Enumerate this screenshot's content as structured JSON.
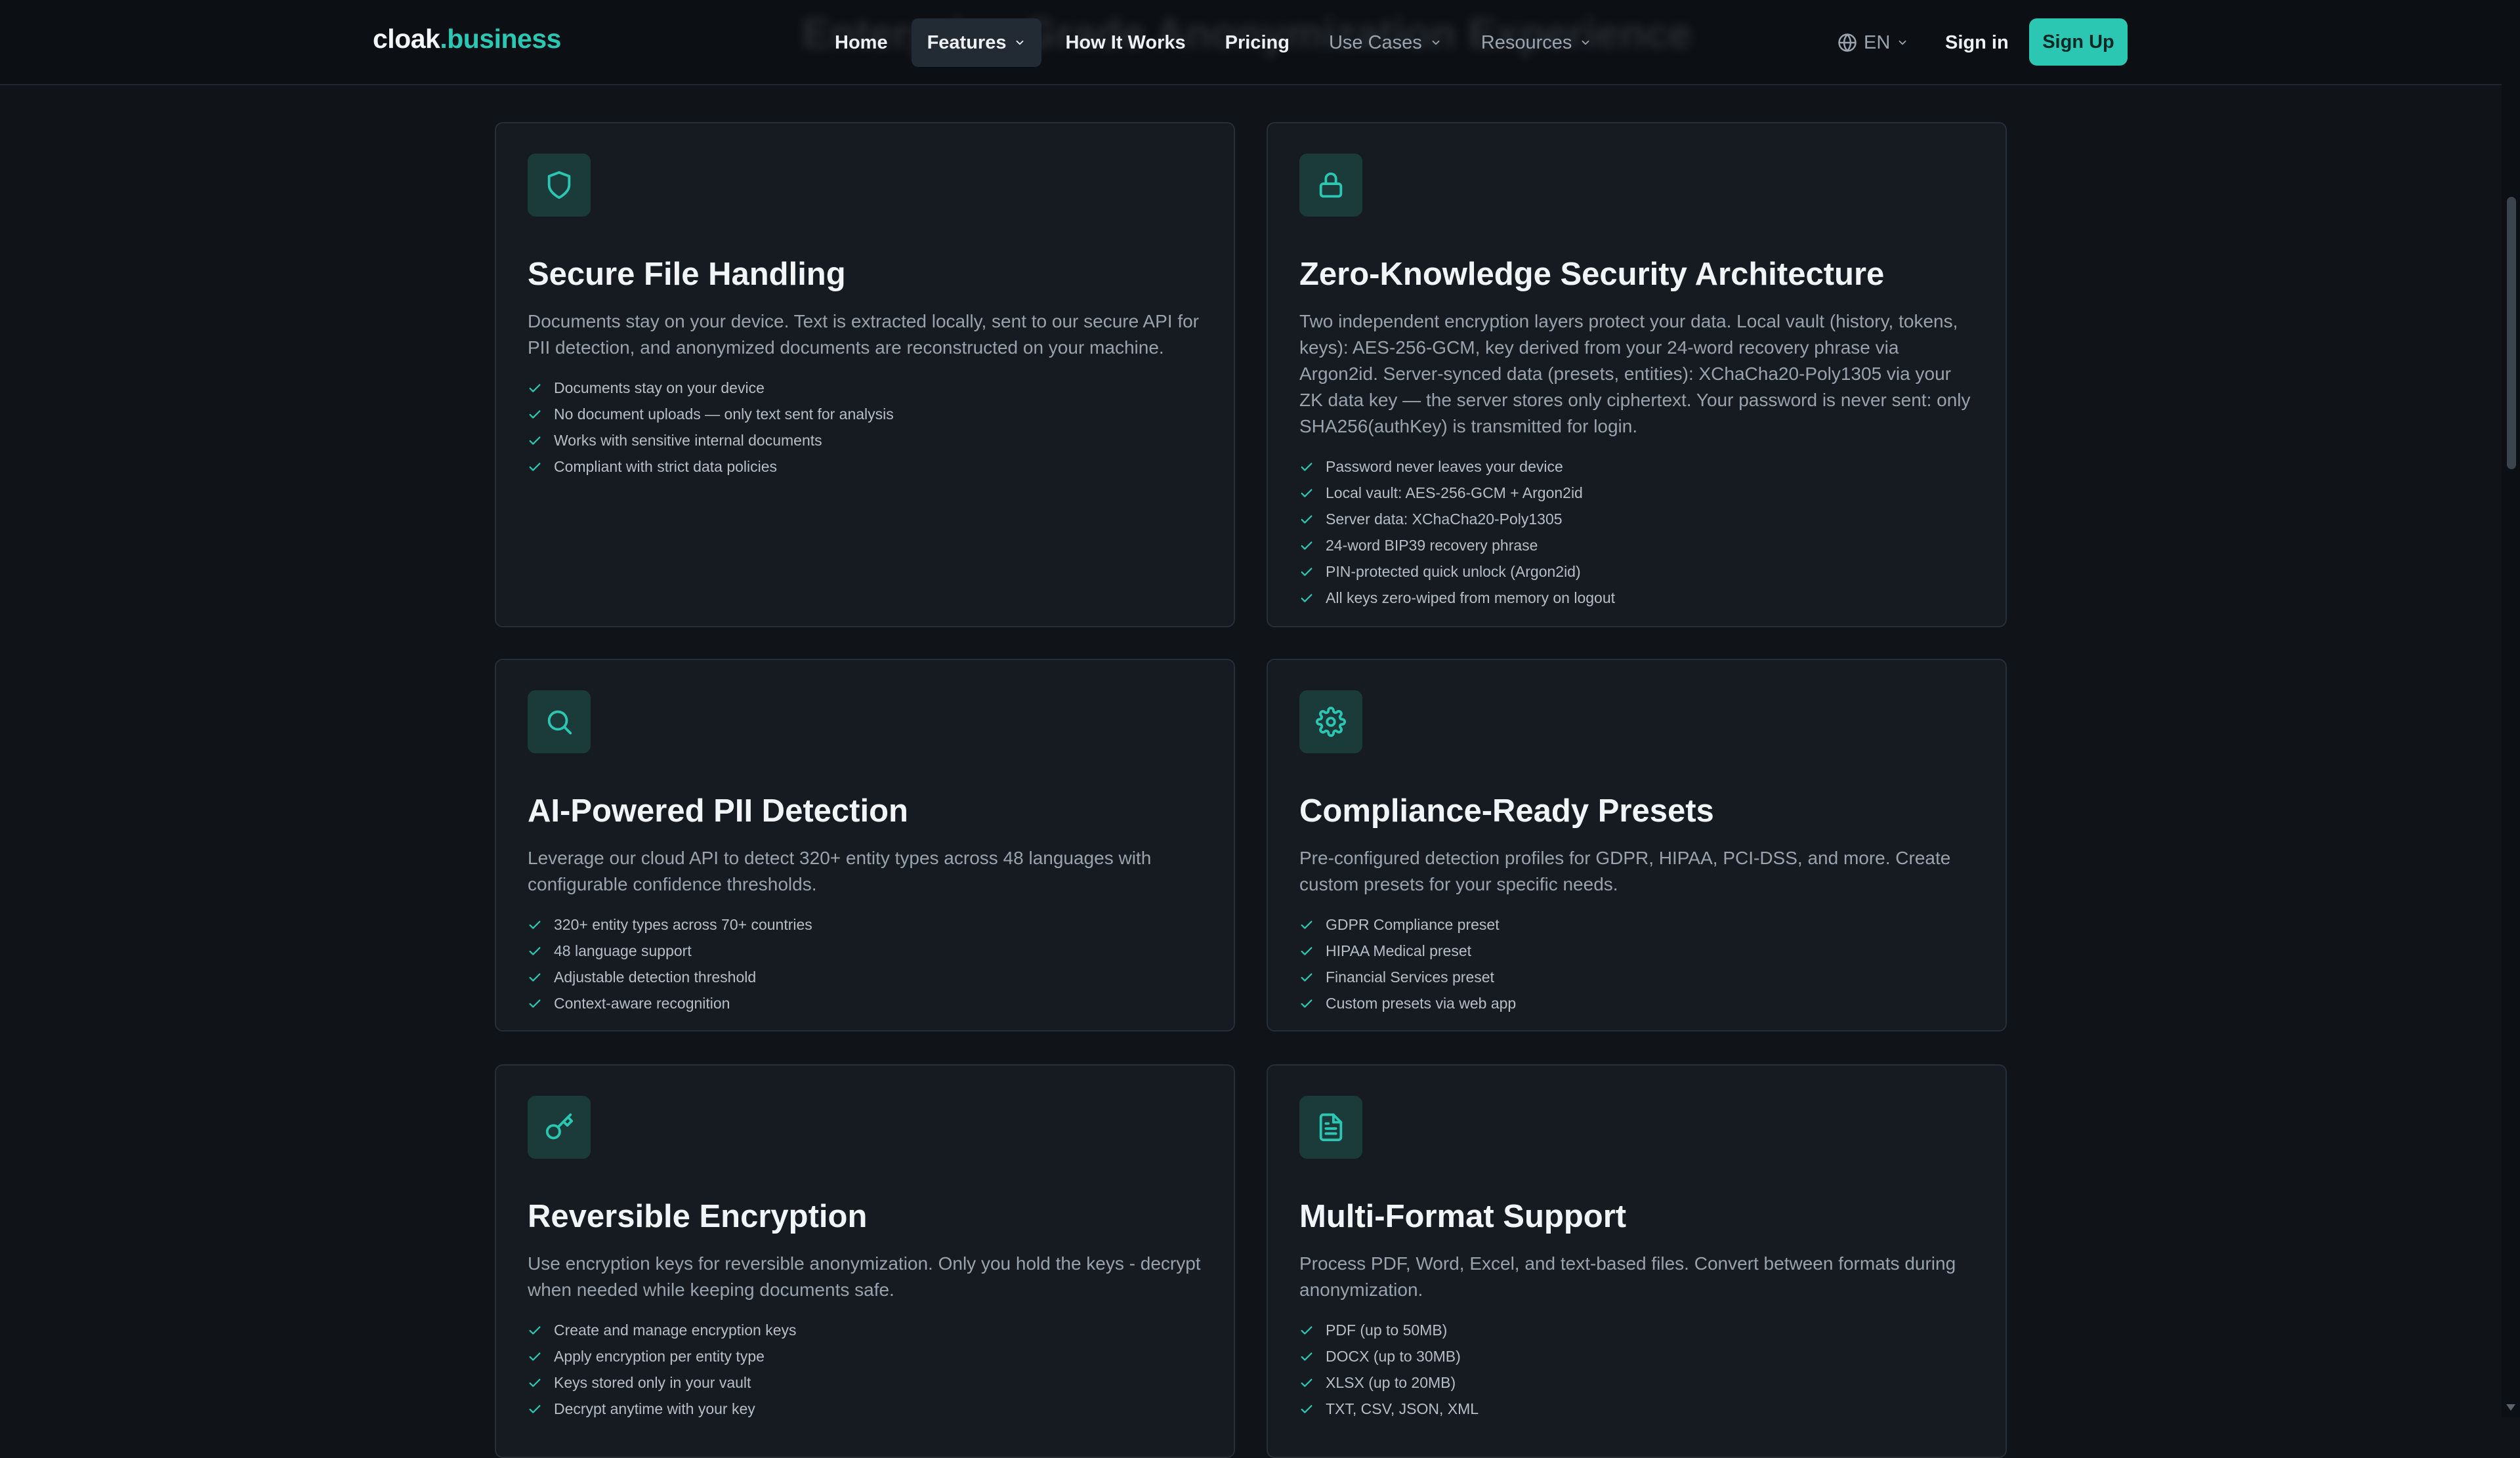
{
  "header": {
    "ghost_heading": "Enterprise-Grade Anonymization Experience",
    "logo": {
      "part1": "cloak",
      "part2": ".business"
    },
    "nav": [
      {
        "label": "Home"
      },
      {
        "label": "Features"
      },
      {
        "label": "How It Works"
      },
      {
        "label": "Pricing"
      },
      {
        "label": "Use Cases"
      },
      {
        "label": "Resources"
      }
    ],
    "language": "EN",
    "sign_in": "Sign in",
    "sign_up": "Sign Up"
  },
  "colors": {
    "accent": "#2cc7b3",
    "background": "#101419",
    "card": "#161b21",
    "icon_bg": "#1b3a3a"
  },
  "cards": [
    {
      "icon": "shield-icon",
      "title": "Secure File Handling",
      "description": "Documents stay on your device. Text is extracted locally, sent to our secure API for PII detection, and anonymized documents are reconstructed on your machine.",
      "features": [
        "Documents stay on your device",
        "No document uploads — only text sent for analysis",
        "Works with sensitive internal documents",
        "Compliant with strict data policies"
      ]
    },
    {
      "icon": "lock-icon",
      "title": "Zero-Knowledge Security Architecture",
      "description": "Two independent encryption layers protect your data. Local vault (history, tokens, keys): AES-256-GCM, key derived from your 24-word recovery phrase via Argon2id. Server-synced data (presets, entities): XChaCha20-Poly1305 via your ZK data key — the server stores only ciphertext. Your password is never sent: only SHA256(authKey) is transmitted for login.",
      "features": [
        "Password never leaves your device",
        "Local vault: AES-256-GCM + Argon2id",
        "Server data: XChaCha20-Poly1305",
        "24-word BIP39 recovery phrase",
        "PIN-protected quick unlock (Argon2id)",
        "All keys zero-wiped from memory on logout"
      ]
    },
    {
      "icon": "search-icon",
      "title": "AI-Powered PII Detection",
      "description": "Leverage our cloud API to detect 320+ entity types across 48 languages with configurable confidence thresholds.",
      "features": [
        "320+ entity types across 70+ countries",
        "48 language support",
        "Adjustable detection threshold",
        "Context-aware recognition"
      ]
    },
    {
      "icon": "gear-icon",
      "title": "Compliance-Ready Presets",
      "description": "Pre-configured detection profiles for GDPR, HIPAA, PCI-DSS, and more. Create custom presets for your specific needs.",
      "features": [
        "GDPR Compliance preset",
        "HIPAA Medical preset",
        "Financial Services preset",
        "Custom presets via web app"
      ]
    },
    {
      "icon": "key-icon",
      "title": "Reversible Encryption",
      "description": "Use encryption keys for reversible anonymization. Only you hold the keys - decrypt when needed while keeping documents safe.",
      "features": [
        "Create and manage encryption keys",
        "Apply encryption per entity type",
        "Keys stored only in your vault",
        "Decrypt anytime with your key"
      ]
    },
    {
      "icon": "file-text-icon",
      "title": "Multi-Format Support",
      "description": "Process PDF, Word, Excel, and text-based files. Convert between formats during anonymization.",
      "features": [
        "PDF (up to 50MB)",
        "DOCX (up to 30MB)",
        "XLSX (up to 20MB)",
        "TXT, CSV, JSON, XML"
      ]
    }
  ]
}
